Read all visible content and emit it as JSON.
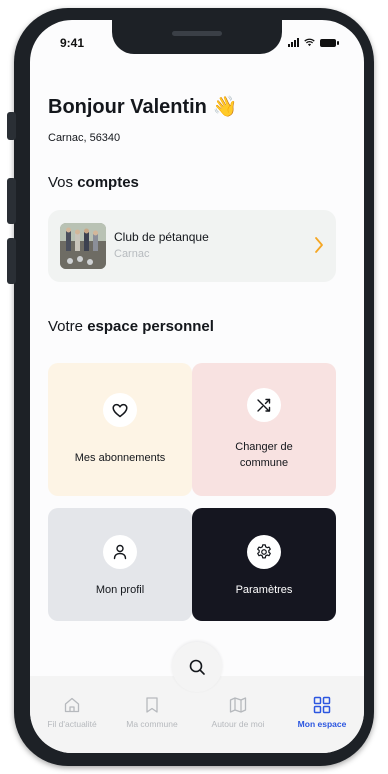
{
  "status_bar": {
    "time": "9:41"
  },
  "header": {
    "greeting": "Bonjour Valentin",
    "greeting_emoji": "👋",
    "location": "Carnac, 56340"
  },
  "accounts": {
    "title_prefix": "Vos",
    "title_bold": "comptes",
    "items": [
      {
        "name": "Club de pétanque",
        "subtitle": "Carnac",
        "thumbnail": "petanque-photo",
        "chevron_icon": "chevron-right-icon"
      }
    ]
  },
  "personal_space": {
    "title_prefix": "Votre",
    "title_bold": "espace personnel",
    "tiles": [
      {
        "label": "Mes abonnements",
        "icon": "heart-icon",
        "background": "#fdf4e5"
      },
      {
        "label": "Changer de commune",
        "icon": "shuffle-icon",
        "background": "#f8e2e1"
      },
      {
        "label": "Mon profil",
        "icon": "user-icon",
        "background": "#e4e6ea"
      },
      {
        "label": "Paramètres",
        "icon": "gear-icon",
        "background": "#151620"
      }
    ]
  },
  "search": {
    "icon": "search-icon"
  },
  "bottom_nav": {
    "items": [
      {
        "label": "Fil d'actualité",
        "icon": "home-icon",
        "active": false
      },
      {
        "label": "Ma commune",
        "icon": "bookmark-icon",
        "active": false
      },
      {
        "label": "Autour de moi",
        "icon": "map-icon",
        "active": false
      },
      {
        "label": "Mon espace",
        "icon": "grid-icon",
        "active": true
      }
    ]
  },
  "colors": {
    "accent": "#2b56e0",
    "chevron": "#f5a623",
    "inactive": "#b6b9bd",
    "dark_tile": "#151620"
  }
}
